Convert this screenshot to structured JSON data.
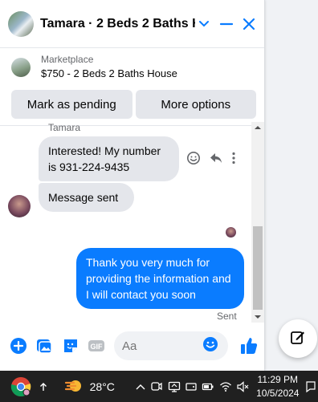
{
  "chat": {
    "title": "Tamara · 2 Beds 2 Baths H…",
    "listing": {
      "source": "Marketplace",
      "description": "$750 - 2 Beds 2 Baths House"
    },
    "buttons": {
      "mark_pending": "Mark as pending",
      "more_options": "More options"
    },
    "messages": {
      "sender_name": "Tamara",
      "incoming_1": "Interested! My number is 931-224-9435",
      "incoming_2": "Message sent",
      "outgoing_1": "Thank you very much for providing the information and I will contact you soon",
      "status": "Sent"
    },
    "composer": {
      "placeholder": "Aa"
    }
  },
  "taskbar": {
    "temperature": "28°C",
    "time": "11:29 PM",
    "date": "10/5/2024"
  },
  "colors": {
    "accent": "#0a7cff",
    "bubble_incoming": "#e4e6eb",
    "taskbar": "#202020"
  }
}
